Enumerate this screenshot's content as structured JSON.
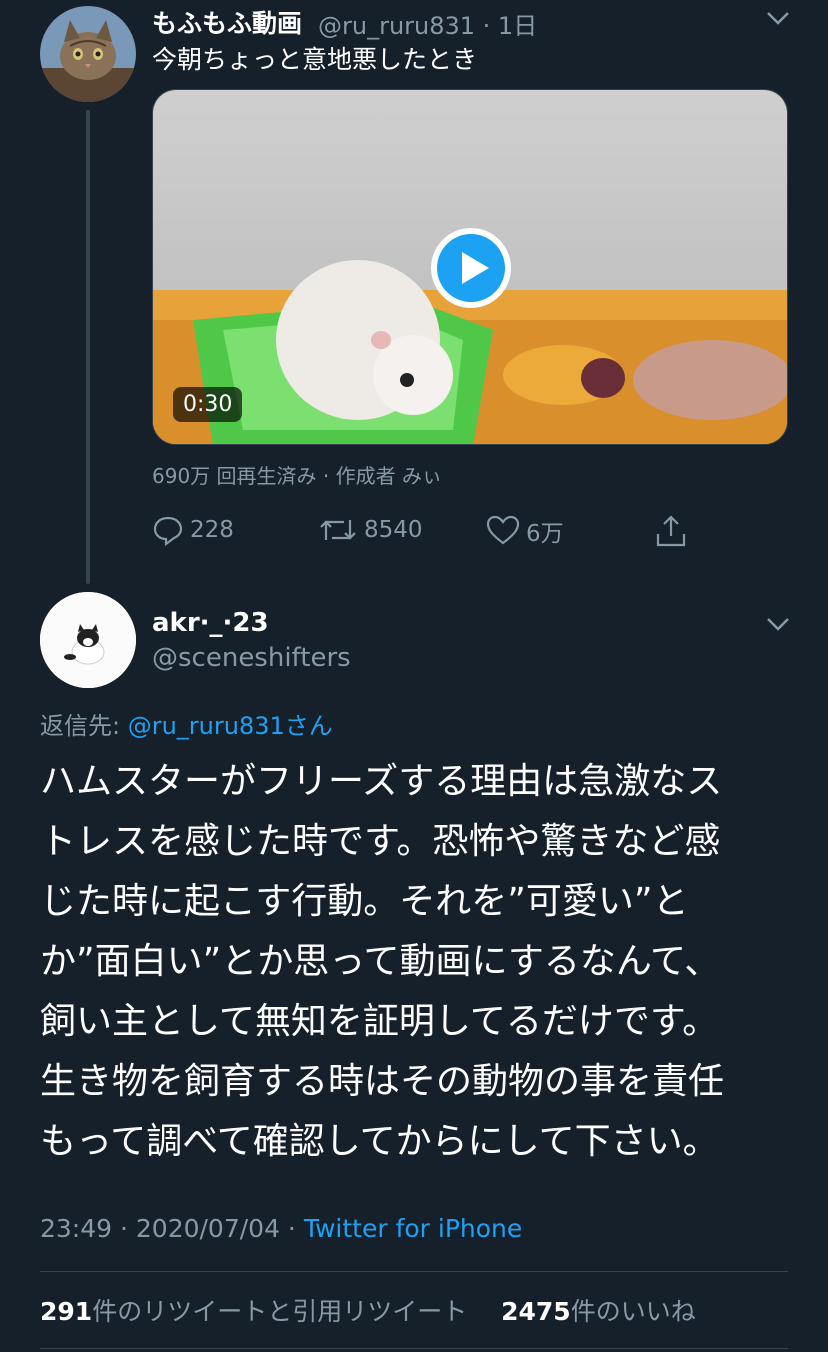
{
  "original_tweet": {
    "display_name": "もふもふ動画",
    "handle_time": "@ru_ruru831 · 1日",
    "text": "今朝ちょっと意地悪したとき",
    "video": {
      "duration": "0:30"
    },
    "views_line": "690万 回再生済み · 作成者 みぃ",
    "actions": {
      "reply_count": "228",
      "retweet_count": "8540",
      "like_count": "6万"
    }
  },
  "reply_tweet": {
    "display_name": "akr·_·23",
    "handle": "@sceneshifters",
    "replying_label": "返信先: ",
    "replying_to": "@ru_ruru831さん",
    "text_lines": [
      "ハムスターがフリーズする理由は急激なス",
      "トレスを感じた時です。恐怖や驚きなど感",
      "じた時に起こす行動。それを”可愛い”と",
      "か”面白い”とか思って動画にするなんて、",
      "飼い主として無知を証明してるだけです。",
      "生き物を飼育する時はその動物の事を責任",
      "もって調べて確認してからにして下さい。"
    ],
    "timestamp": "23:49 · 2020/07/04 · ",
    "source": "Twitter for iPhone",
    "stats": {
      "retweets_num": "291",
      "retweets_label": "件のリツイートと引用リツイート",
      "likes_num": "2475",
      "likes_label": "件のいいね"
    }
  },
  "colors": {
    "background": "#15202b",
    "muted": "#8899a6",
    "link": "#1da1f2",
    "divider": "#38444d",
    "play": "#1da1f2"
  }
}
